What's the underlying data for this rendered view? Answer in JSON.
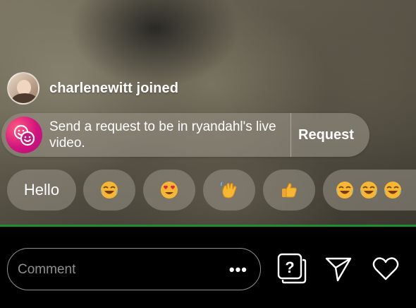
{
  "join_notice": {
    "username": "charlenewitt",
    "text": "charlenewitt joined"
  },
  "request_banner": {
    "text": "Send a request to be in ryandahl's live video.",
    "button_label": "Request",
    "icon": "guest-faces-icon",
    "icon_color": "#d2137f"
  },
  "quick_replies": [
    {
      "label": "Hello",
      "kind": "text"
    },
    {
      "label": "😂",
      "kind": "emoji",
      "icon": "tears-of-joy-emoji"
    },
    {
      "label": "😍",
      "kind": "emoji",
      "icon": "heart-eyes-emoji"
    },
    {
      "label": "👋",
      "kind": "emoji",
      "icon": "waving-hand-emoji"
    },
    {
      "label": "👍",
      "kind": "emoji",
      "icon": "thumbs-up-emoji"
    },
    {
      "label": "😂😂😂",
      "kind": "emoji",
      "icon": "tears-of-joy-emoji-x3"
    }
  ],
  "composer": {
    "placeholder": "Comment",
    "more_label": "•••",
    "icons": [
      "question-sticker-icon",
      "send-icon",
      "heart-icon"
    ]
  },
  "colors": {
    "live_border": "#1e8f2e",
    "overlay_chip": "rgba(150,145,132,0.6)",
    "background": "#000000"
  }
}
